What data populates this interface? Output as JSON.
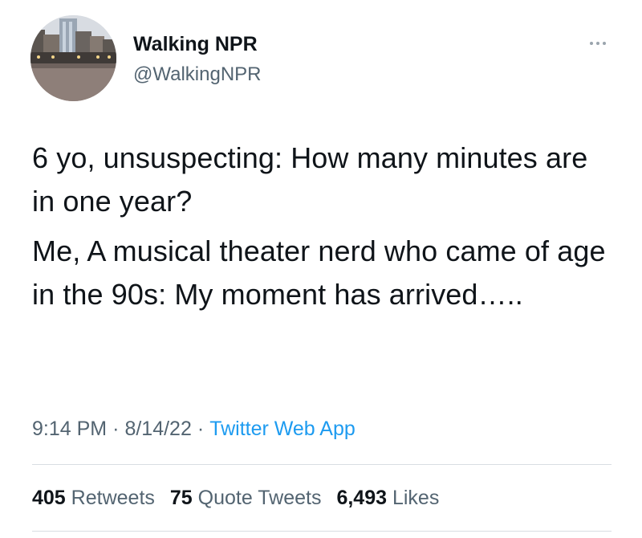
{
  "author": {
    "name": "Walking NPR",
    "handle": "@WalkingNPR"
  },
  "tweet": {
    "paragraphs": [
      "6 yo, unsuspecting: How many minutes are in one year?",
      "Me, A musical theater nerd who came of age in the 90s: My moment has arrived….."
    ]
  },
  "meta": {
    "time": "9:14 PM",
    "date": "8/14/22",
    "separator": "·",
    "source": "Twitter Web App"
  },
  "stats": {
    "retweets": {
      "count": "405",
      "label": "Retweets"
    },
    "quote_tweets": {
      "count": "75",
      "label": "Quote Tweets"
    },
    "likes": {
      "count": "6,493",
      "label": "Likes"
    }
  },
  "colors": {
    "text": "#0f1419",
    "secondary": "#536471",
    "link": "#1d9bf0",
    "divider": "#d9dee2"
  },
  "icons": [
    "more-icon"
  ]
}
